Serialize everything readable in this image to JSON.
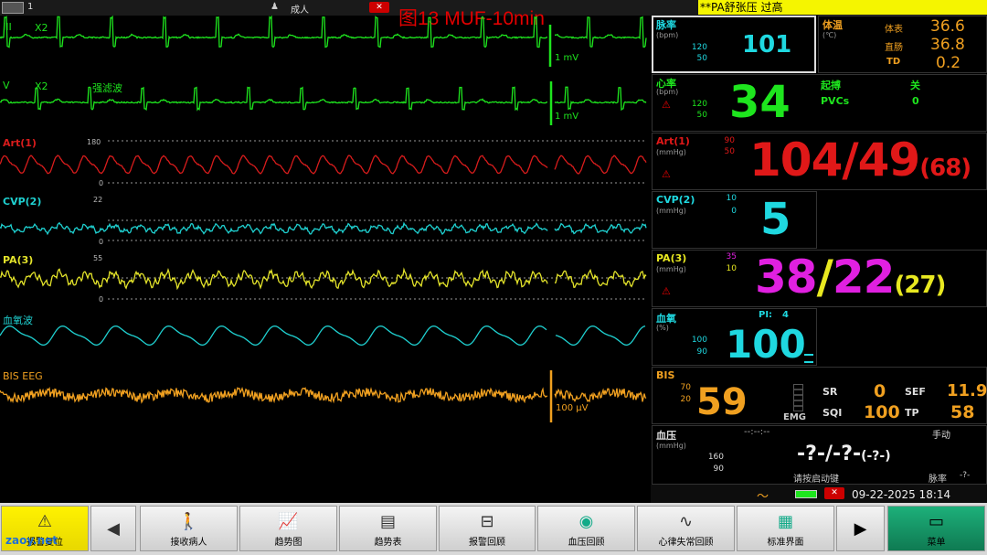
{
  "top_bar": {
    "bed_number": "1",
    "patient_type": "成人",
    "figure_title": "图13 MUF-10min",
    "alarm_message": "**PA舒张压 过高"
  },
  "waves": [
    {
      "label": "III",
      "gain": "X2",
      "scale": "1 mV",
      "color": "#1ee51e"
    },
    {
      "label": "V",
      "gain": "X2",
      "filter": "强滤波",
      "scale": "1 mV",
      "color": "#1ee51e"
    },
    {
      "label": "Art(1)",
      "scale_top": "180",
      "scale_bottom": "0",
      "color": "#d81c1c"
    },
    {
      "label": "CVP(2)",
      "scale_top": "22",
      "scale_bottom": "0",
      "color": "#1fd0d0"
    },
    {
      "label": "PA(3)",
      "scale_top": "55",
      "scale_bottom": "0",
      "color": "#e3e32a"
    },
    {
      "label": "血氧波",
      "color": "#1fd0d0"
    },
    {
      "label": "BIS EEG",
      "scale": "100 μV",
      "color": "#f0a020"
    }
  ],
  "params": {
    "pulse": {
      "label": "脉率",
      "unit": "(bpm)",
      "high": "120",
      "low": "50",
      "value": "101"
    },
    "temp": {
      "label": "体温",
      "unit": "(℃)",
      "rows": [
        {
          "name": "体表",
          "value": "36.6"
        },
        {
          "name": "直肠",
          "value": "36.8"
        },
        {
          "name": "TD",
          "value": "0.2"
        }
      ]
    },
    "hr": {
      "label": "心率",
      "unit": "(bpm)",
      "high": "120",
      "low": "50",
      "value": "34",
      "pacer_label": "起搏",
      "pacer_value": "关",
      "pvcs_label": "PVCs",
      "pvcs_value": "0"
    },
    "art": {
      "label": "Art(1)",
      "unit": "(mmHg)",
      "high": "90",
      "low": "50",
      "sys": "104",
      "dia": "49",
      "mean": "(68)"
    },
    "cvp": {
      "label": "CVP(2)",
      "unit": "(mmHg)",
      "high": "10",
      "low": "0",
      "value": "5"
    },
    "pa": {
      "label": "PA(3)",
      "unit": "(mmHg)",
      "high": "35",
      "low": "10",
      "sys": "38",
      "dia": "22",
      "mean": "(27)"
    },
    "spo2": {
      "label": "血氧",
      "unit": "(%)",
      "pi_label": "PI:",
      "pi_value": "4",
      "high": "100",
      "low": "90",
      "value": "100"
    },
    "bis": {
      "label": "BIS",
      "high": "70",
      "low": "20",
      "value": "59",
      "emg_label": "EMG",
      "sr_label": "SR",
      "sr_value": "0",
      "sef_label": "SEF",
      "sef_value": "11.9",
      "sqi_label": "SQI",
      "sqi_value": "100",
      "tp_label": "TP",
      "tp_value": "58"
    },
    "nibp": {
      "label": "血压",
      "unit": "(mmHg)",
      "high": "160",
      "low": "90",
      "time": "--:--:--",
      "mode": "手动",
      "value": "-?-/-?-",
      "mean": "(-?-)",
      "hint": "请按启动键",
      "pulse_label": "脉率",
      "pulse_value": "-?-"
    }
  },
  "status": {
    "datetime": "09-22-2025  18:14"
  },
  "buttons": [
    {
      "label": "报警复位",
      "icon": "alarm-reset-icon"
    },
    {
      "label": "接收病人",
      "icon": "admit-patient-icon"
    },
    {
      "label": "趋势图",
      "icon": "trend-graph-icon"
    },
    {
      "label": "趋势表",
      "icon": "trend-table-icon"
    },
    {
      "label": "报警回顾",
      "icon": "alarm-review-icon"
    },
    {
      "label": "血压回顾",
      "icon": "nibp-review-icon"
    },
    {
      "label": "心律失常回顾",
      "icon": "arrhythmia-review-icon"
    },
    {
      "label": "标准界面",
      "icon": "standard-screen-icon"
    },
    {
      "label": "菜单",
      "icon": "menu-icon"
    }
  ],
  "watermark": "zaoy.net",
  "colors": {
    "green": "#1ee51e",
    "red": "#e01818",
    "cyan": "#1fd8e0",
    "magenta": "#e020e0",
    "yellow": "#e8e820",
    "orange": "#f0a020"
  }
}
